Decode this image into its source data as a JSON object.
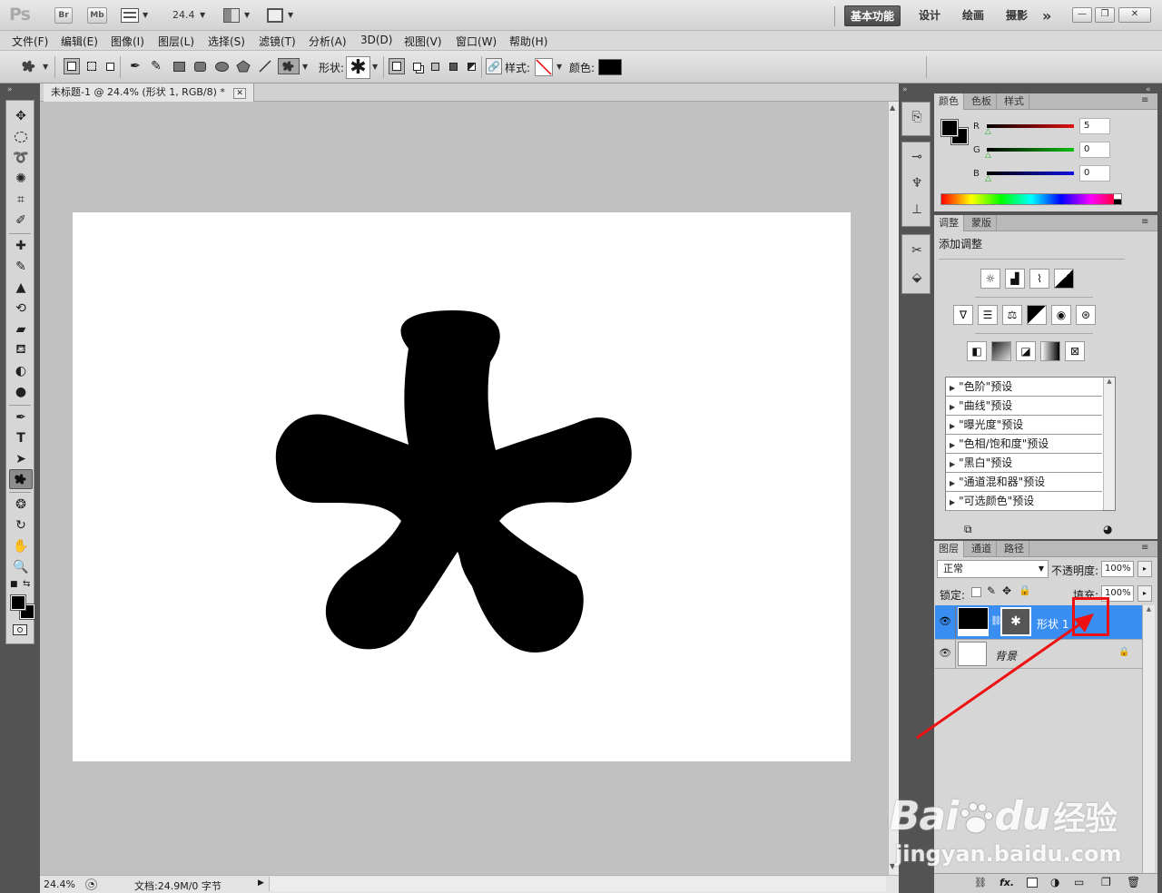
{
  "app": {
    "logo": "Ps",
    "bridge": "Br",
    "mini_bridge": "Mb",
    "zoom": "24.4"
  },
  "workspaces": {
    "active": "基本功能",
    "items": [
      "设计",
      "绘画",
      "摄影"
    ],
    "more": "»"
  },
  "menu": [
    "文件(F)",
    "编辑(E)",
    "图像(I)",
    "图层(L)",
    "选择(S)",
    "滤镜(T)",
    "分析(A)",
    "3D(D)",
    "视图(V)",
    "窗口(W)",
    "帮助(H)"
  ],
  "options": {
    "shape_label": "形状:",
    "style_label": "样式:",
    "color_label": "颜色:",
    "color_value": "#000000"
  },
  "document": {
    "tab_title": "未标题-1 @ 24.4% (形状 1, RGB/8) *",
    "close": "✕"
  },
  "status": {
    "zoom": "24.4%",
    "doc_info": "文档:24.9M/0 字节"
  },
  "color_panel": {
    "tabs": [
      "颜色",
      "色板",
      "样式"
    ],
    "channels": [
      {
        "label": "R",
        "value": "5",
        "color": "#e01010"
      },
      {
        "label": "G",
        "value": "0",
        "color": "#10c010"
      },
      {
        "label": "B",
        "value": "0",
        "color": "#1010e0"
      }
    ]
  },
  "adjust_panel": {
    "tabs": [
      "调整",
      "蒙版"
    ],
    "title": "添加调整",
    "presets": [
      "\"色阶\"预设",
      "\"曲线\"预设",
      "\"曝光度\"预设",
      "\"色相/饱和度\"预设",
      "\"黑白\"预设",
      "\"通道混和器\"预设",
      "\"可选颜色\"预设"
    ]
  },
  "layers_panel": {
    "tabs": [
      "图层",
      "通道",
      "路径"
    ],
    "blend_mode": "正常",
    "opacity_label": "不透明度:",
    "opacity_value": "100%",
    "lock_label": "锁定:",
    "fill_label": "填充:",
    "fill_value": "100%",
    "layers": [
      {
        "name": "形状 1",
        "selected": true
      },
      {
        "name": "背景",
        "selected": false
      }
    ]
  },
  "annotation": {
    "color": "#ff0000"
  },
  "watermark": {
    "brand_a": "Bai",
    "brand_b": "du",
    "brand_cn": "经验",
    "url": "jingyan.baidu.com"
  }
}
